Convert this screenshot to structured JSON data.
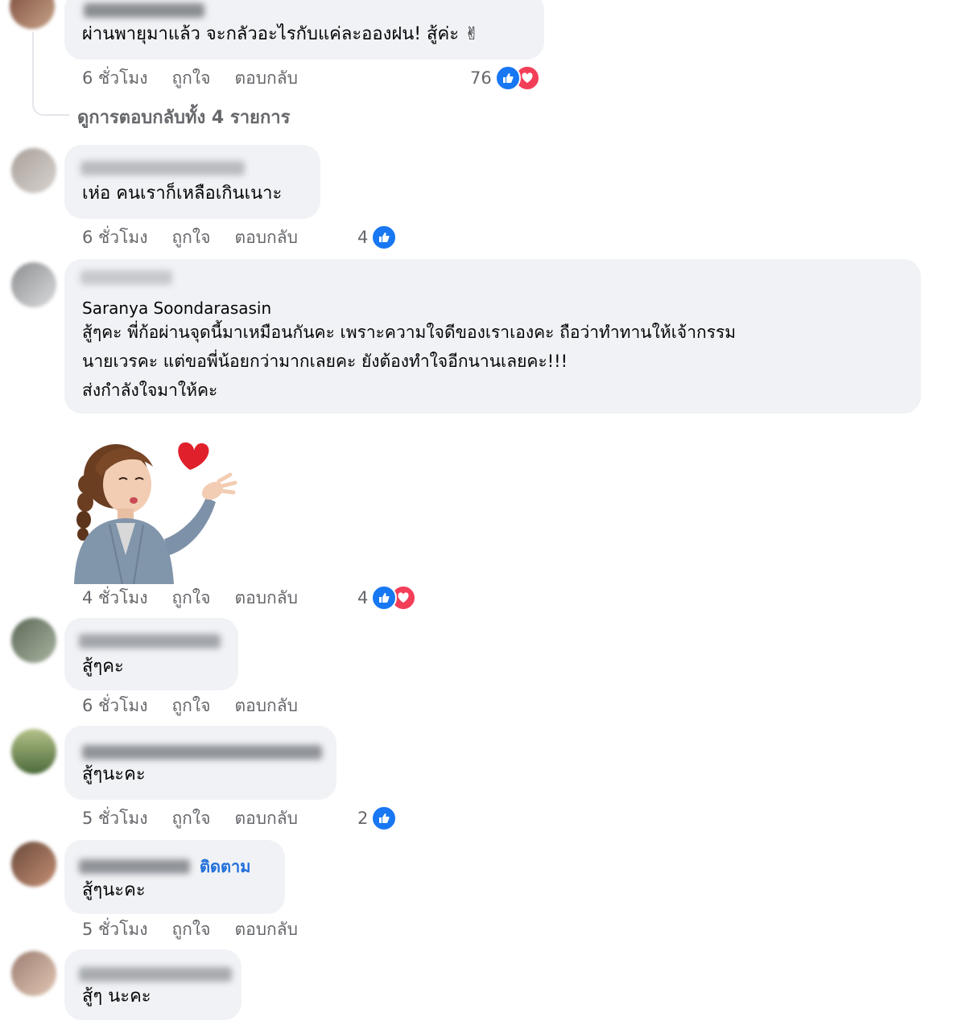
{
  "comments": [
    {
      "text": "ผ่านพายุมาแล้ว จะกลัวอะไรกับแค่ละอองฝน! สู้ค่ะ ✌",
      "time": "6 ชั่วโมง",
      "like": "ถูกใจ",
      "reply": "ตอบกลับ",
      "reaction_count": "76",
      "reactions": [
        "like-icon",
        "love-icon"
      ]
    },
    {
      "text": "เห่อ คนเราก็เหลือเกินเนาะ",
      "time": "6 ชั่วโมง",
      "like": "ถูกใจ",
      "reply": "ตอบกลับ",
      "reaction_count": "4",
      "reactions": [
        "like-icon"
      ]
    },
    {
      "tagged_name": "Saranya Soondarasasin",
      "text_lines": [
        "สู้ๆคะ พี่ก้อผ่านจุดนี้มาเหมือนกันคะ เพราะความใจดีของเราเองคะ ถือว่าทำทานให้เจ้ากรรม",
        "นายเวรคะ แต่ขอพี่น้อยกว่ามากเลยคะ ยังต้องทำใจอีกนานเลยคะ!!!",
        "ส่งกำลังใจมาให้คะ"
      ],
      "time": "4 ชั่วโมง",
      "like": "ถูกใจ",
      "reply": "ตอบกลับ",
      "reaction_count": "4",
      "reactions": [
        "like-icon",
        "love-icon"
      ]
    },
    {
      "text": "สู้ๆคะ",
      "time": "6 ชั่วโมง",
      "like": "ถูกใจ",
      "reply": "ตอบกลับ"
    },
    {
      "text": "สู้ๆนะคะ",
      "time": "5 ชั่วโมง",
      "like": "ถูกใจ",
      "reply": "ตอบกลับ",
      "reaction_count": "2",
      "reactions": [
        "like-icon"
      ]
    },
    {
      "follow_label": "ติดตาม",
      "text": "สู้ๆนะคะ",
      "time": "5 ชั่วโมง",
      "like": "ถูกใจ",
      "reply": "ตอบกลับ"
    },
    {
      "text": "สู้ๆ นะคะ"
    }
  ],
  "view_more_replies": "ดูการตอบกลับทั้ง 4 รายการ",
  "colors": {
    "like": "#1877f2",
    "love": "#f33e58",
    "bubble": "#f0f2f5",
    "meta": "#65676b",
    "link": "#216fdb"
  }
}
